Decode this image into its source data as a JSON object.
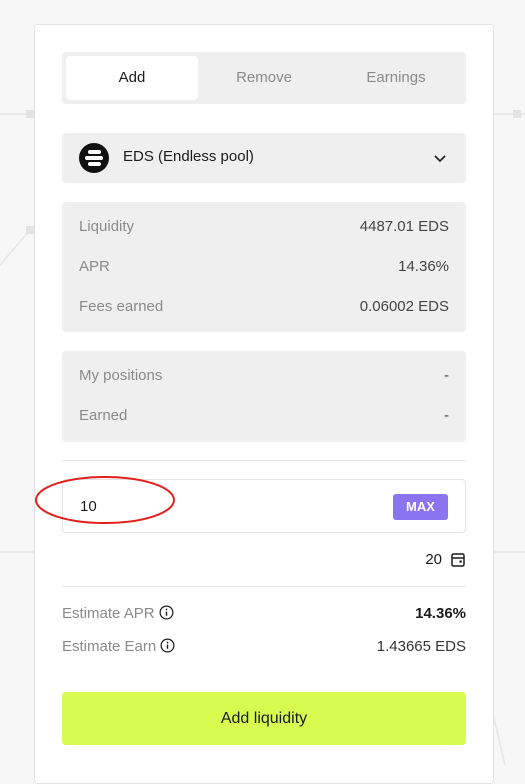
{
  "tabs": [
    {
      "label": "Add",
      "active": true
    },
    {
      "label": "Remove",
      "active": false
    },
    {
      "label": "Earnings",
      "active": false
    }
  ],
  "pool": {
    "name": "EDS (Endless pool)",
    "logo_icon": "eds-logo-icon",
    "dropdown_icon": "chevron-down-icon"
  },
  "stats": {
    "liquidity_label": "Liquidity",
    "liquidity_value": "4487.01 EDS",
    "apr_label": "APR",
    "apr_value": "14.36%",
    "fees_label": "Fees earned",
    "fees_value": "0.06002 EDS"
  },
  "positions": {
    "my_positions_label": "My positions",
    "my_positions_value": "-",
    "earned_label": "Earned",
    "earned_value": "-"
  },
  "amount_input": {
    "value": "10",
    "max_label": "MAX"
  },
  "balance": {
    "value": "20",
    "icon": "wallet-icon"
  },
  "estimate": {
    "apr_label": "Estimate APR",
    "apr_value": "14.36%",
    "earn_label": "Estimate Earn",
    "earn_value": "1.43665 EDS",
    "info_icon": "info-icon"
  },
  "submit_label": "Add liquidity",
  "colors": {
    "accent_button": "#d8fb4f",
    "max_button": "#8b74f0",
    "annotation": "#e0201c"
  }
}
